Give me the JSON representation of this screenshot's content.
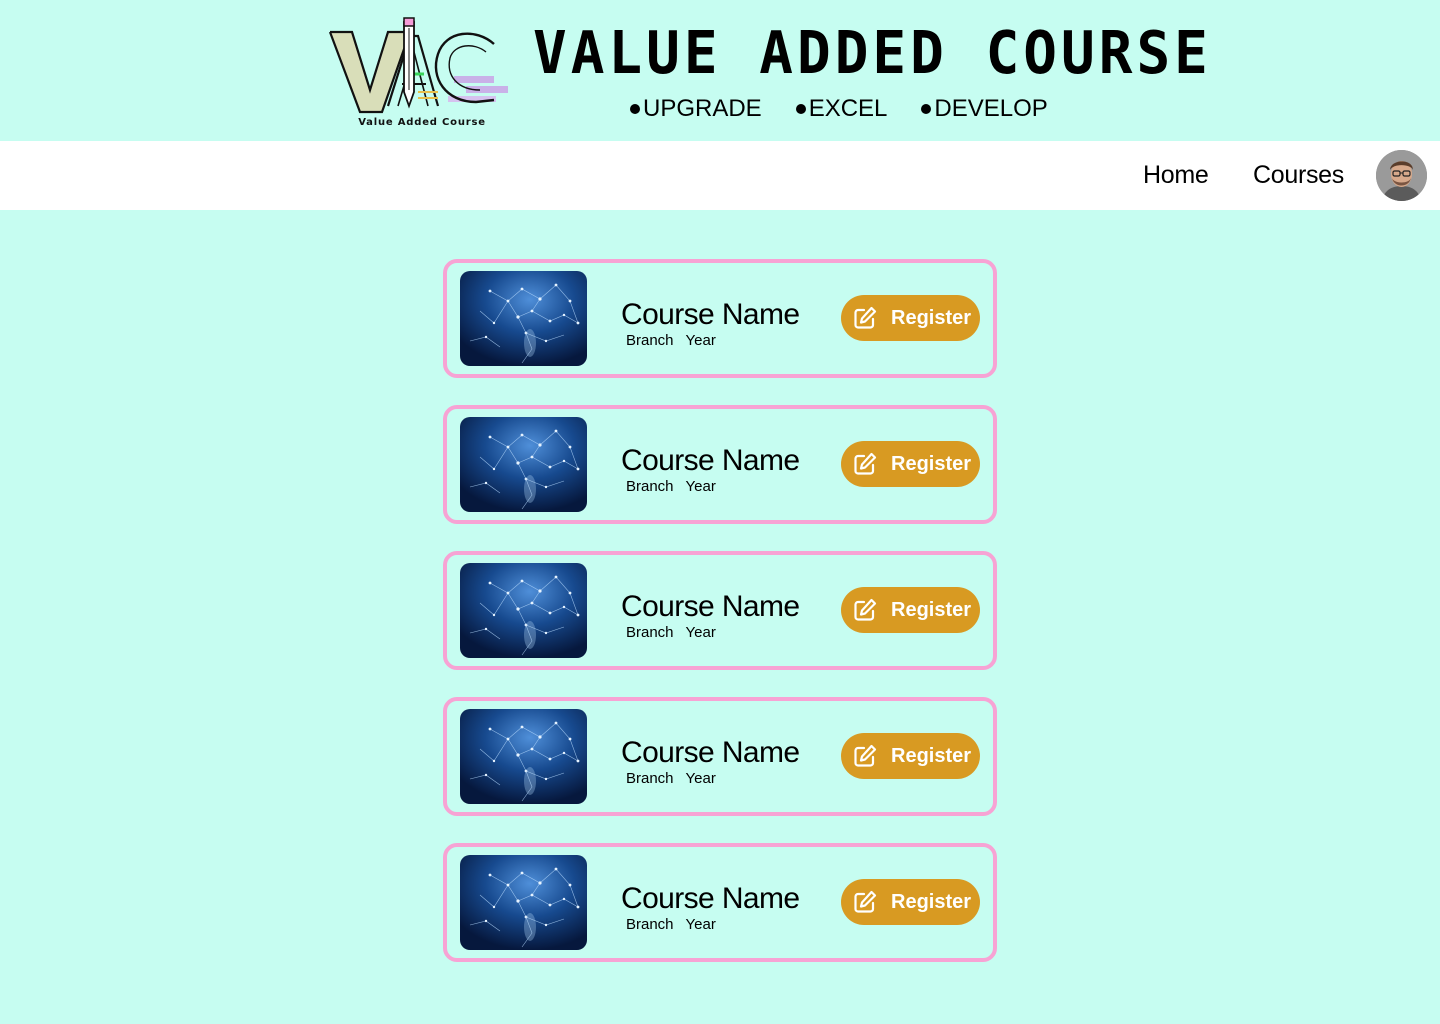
{
  "header": {
    "logo_letters": "VAC",
    "logo_caption": "Value Added Course",
    "title": "VALUE ADDED COURSE",
    "taglines": [
      "UPGRADE",
      "EXCEL",
      "DEVELOP"
    ]
  },
  "nav": {
    "home": "Home",
    "courses": "Courses",
    "avatar_icon": "user-avatar"
  },
  "courses": [
    {
      "name": "Course Name",
      "branch": "Branch",
      "year": "Year",
      "register_label": "Register",
      "icon": "edit-icon"
    },
    {
      "name": "Course Name",
      "branch": "Branch",
      "year": "Year",
      "register_label": "Register",
      "icon": "edit-icon"
    },
    {
      "name": "Course Name",
      "branch": "Branch",
      "year": "Year",
      "register_label": "Register",
      "icon": "edit-icon"
    },
    {
      "name": "Course Name",
      "branch": "Branch",
      "year": "Year",
      "register_label": "Register",
      "icon": "edit-icon"
    },
    {
      "name": "Course Name",
      "branch": "Branch",
      "year": "Year",
      "register_label": "Register",
      "icon": "edit-icon"
    }
  ],
  "colors": {
    "background": "#c6fdf1",
    "card_border": "#f7a3d4",
    "register_button": "#d89a22",
    "navbar": "#ffffff"
  }
}
